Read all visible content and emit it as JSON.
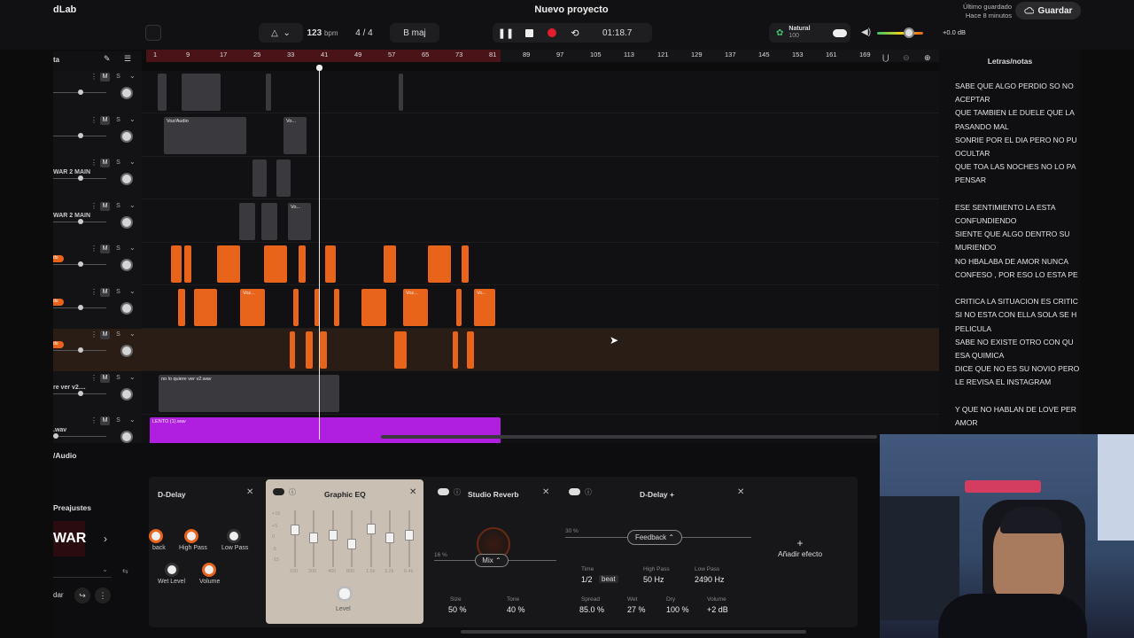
{
  "header": {
    "app_name": "dLab",
    "project_title": "Nuevo proyecto",
    "saved_line1": "Último guardado",
    "saved_line2": "Hace 8 minutos",
    "save_label": "Guardar",
    "tempo_value": "123",
    "tempo_unit": "bpm",
    "time_signature": "4 / 4",
    "key": "B maj",
    "time_display": "01:18.7",
    "preset_name": "Natural",
    "preset_value": "100",
    "master_gain": "+0.0 dB",
    "volume_level": 0.75
  },
  "sidebar_header": {
    "label": "ta"
  },
  "ruler": {
    "ticks": [
      "1",
      "9",
      "17",
      "25",
      "33",
      "41",
      "49",
      "57",
      "65",
      "73",
      "81",
      "89",
      "97",
      "105",
      "113",
      "121",
      "129",
      "137",
      "145",
      "153",
      "161",
      "169"
    ]
  },
  "tracks": [
    {
      "name": "",
      "mute": "M",
      "solo": "S",
      "clips": []
    },
    {
      "name": "",
      "mute": "M",
      "solo": "S",
      "clips": [
        {
          "label": "Voz/Audio"
        },
        {
          "label": "Vo..."
        }
      ]
    },
    {
      "name": "WAR 2 MAIN",
      "mute": "M",
      "solo": "S",
      "clips": []
    },
    {
      "name": "WAR 2 MAIN",
      "mute": "M",
      "solo": "S",
      "clips": [
        {
          "label": "Vo..."
        }
      ]
    },
    {
      "name": "",
      "tag": "do",
      "mute": "M",
      "solo": "S",
      "clips": []
    },
    {
      "name": "",
      "tag": "do",
      "mute": "M",
      "solo": "S",
      "clips": [
        {
          "label": "Voz..."
        },
        {
          "label": "Voz..."
        },
        {
          "label": "Vo..."
        }
      ]
    },
    {
      "name": "",
      "tag": "do",
      "mute": "M",
      "solo": "S",
      "clips": []
    },
    {
      "name": "re ver v2....",
      "mute": "M",
      "solo": "S",
      "clips": [
        {
          "label": "no lo quiere ver v2.wav"
        }
      ]
    },
    {
      "name": ".wav",
      "mute": "M",
      "solo": "S",
      "clips": [
        {
          "label": "LENTO (1).wav"
        }
      ]
    }
  ],
  "lyrics": {
    "title": "Letras/notas",
    "lines": [
      "SABE QUE ALGO PERDIO SO NO",
      "ACEPTAR",
      "QUE TAMBIEN LE DUELE QUE LA",
      "PASANDO MAL",
      "SONRIE POR EL DIA PERO NO PU",
      "OCULTAR",
      "QUE TOA LAS NOCHES NO LO PA",
      "PENSAR",
      "",
      "ESE SENTIMIENTO LA ESTA",
      "CONFUNDIENDO",
      "SIENTE QUE ALGO DENTRO   SU",
      "MURIENDO",
      "NO HBALABA DE AMOR NUNCA",
      "CONFESO , POR ESO LO ESTA PE",
      "",
      "CRITICA LA SITUACION ES CRITIC",
      "SI NO ESTA CON ELLA SOLA SE H",
      "PELICULA",
      "SABE NO EXISTE OTRO CON QU",
      "ESA QUIMICA",
      "DICE QUE NO ES SU NOVIO PERO",
      "LE REVISA EL INSTAGRAM",
      "",
      "Y QUE NO HABLAN DE LOVE PER",
      "AMOR"
    ]
  },
  "bottom": {
    "audio_label": "/Audio",
    "presets_label": "Preajustes",
    "preset_art_text": "WAR",
    "save_preset": "dar"
  },
  "effects": {
    "d_delay": {
      "title": "D-Delay",
      "knobs": [
        "back",
        "High Pass",
        "Low Pass",
        "Wet Level",
        "Volume"
      ]
    },
    "graphic_eq": {
      "title": "Graphic EQ",
      "scale": [
        "+15",
        "+5",
        "0",
        "-5",
        "-15"
      ],
      "bands": [
        "100",
        "200",
        "400",
        "800",
        "1.6k",
        "3.2k",
        "6.4k"
      ],
      "level_label": "Level"
    },
    "studio_reverb": {
      "title": "Studio Reverb",
      "mix_label": "Mix",
      "mix_percent": "16 %",
      "size_label": "Size",
      "size_value": "50 %",
      "tone_label": "Tone",
      "tone_value": "40 %"
    },
    "d_delay_plus": {
      "title": "D-Delay +",
      "feedback_label": "Feedback",
      "feedback_percent": "30 %",
      "time_label": "Time",
      "time_value": "1/2",
      "time_unit": "beat",
      "high_pass_label": "High Pass",
      "high_pass_value": "50 Hz",
      "low_pass_label": "Low Pass",
      "low_pass_value": "2490 Hz",
      "spread_label": "Spread",
      "spread_value": "85.0 %",
      "wet_label": "Wet",
      "wet_value": "27 %",
      "dry_label": "Dry",
      "dry_value": "100 %",
      "volume_label": "Volume",
      "volume_value": "+2 dB"
    },
    "add_effect_label": "Añadir efecto"
  },
  "colors": {
    "accent_orange": "#e8641b",
    "record_red": "#e01e2e",
    "clip_purple": "#b01ee0",
    "eq_panel": "#c9c0b3"
  }
}
